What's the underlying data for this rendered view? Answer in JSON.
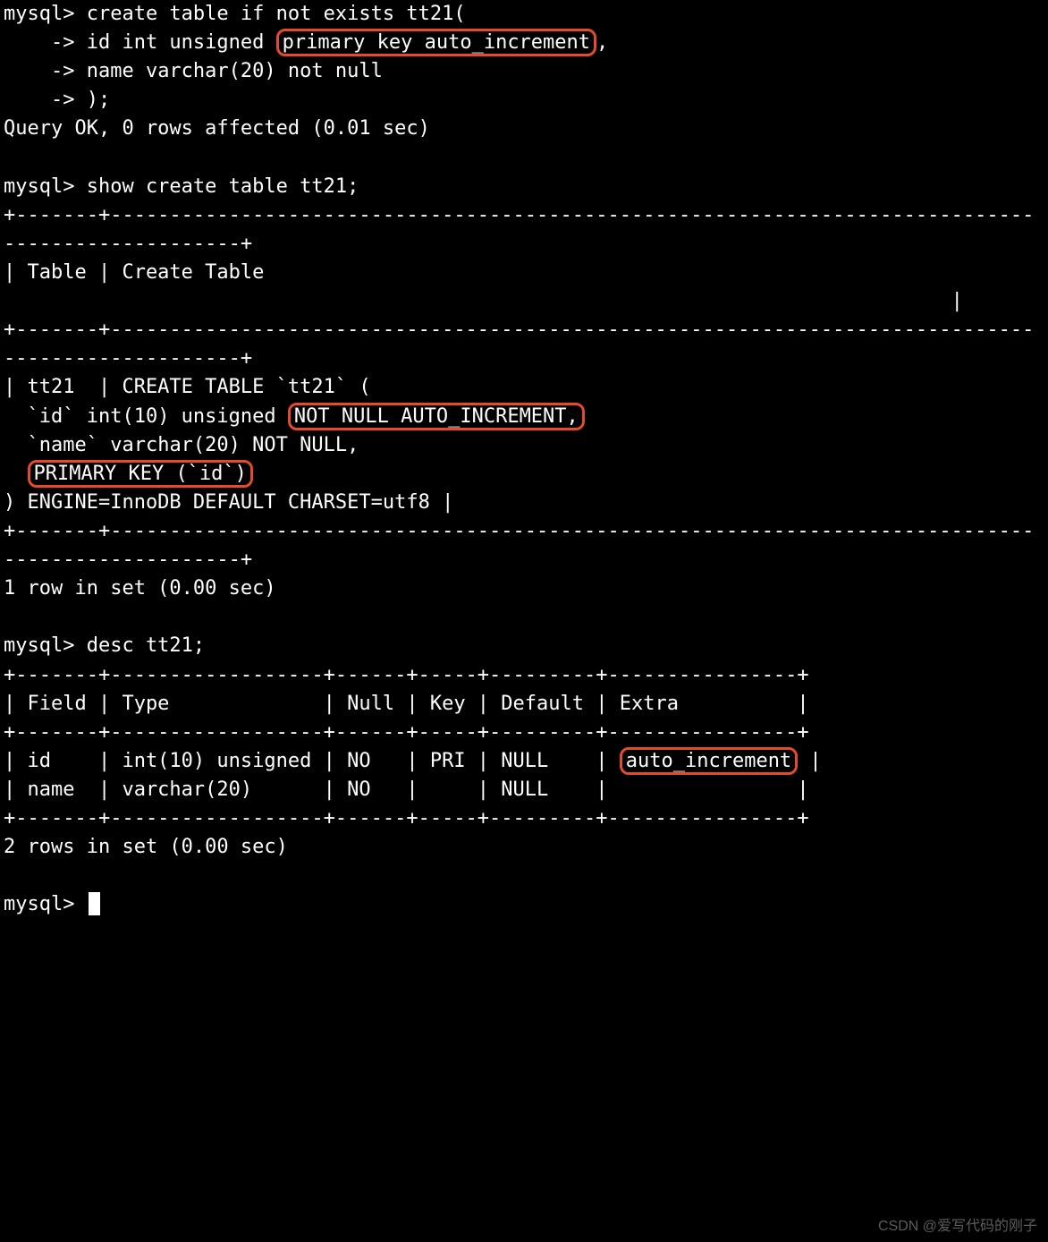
{
  "lines": {
    "l1a": "mysql> create table if not exists tt21(",
    "l2a": "    -> id int unsigned ",
    "l2b": "primary key auto_increment",
    "l2c": ",",
    "l3": "    -> name varchar(20) not null",
    "l4": "    -> );",
    "l5": "Query OK, 0 rows affected (0.01 sec)",
    "l6": "",
    "l7": "mysql> show create table tt21;",
    "l8": "+-------+--------------------------------------------------------------------------------------------------+",
    "l9": "| Table | Create Table                                                                                      ",
    "l9b": "                                                                                |",
    "l10": "+-------+--------------------------------------------------------------------------------------------------+",
    "l11": "| tt21  | CREATE TABLE `tt21` (",
    "l12a": "  `id` int(10) unsigned ",
    "l12b": "NOT NULL AUTO_INCREMENT,",
    "l13": "  `name` varchar(20) NOT NULL,",
    "l14a": "  ",
    "l14b": "PRIMARY KEY (`id`)",
    "l15": ") ENGINE=InnoDB DEFAULT CHARSET=utf8 |",
    "l16": "+-------+--------------------------------------------------------------------------------------------------+",
    "l17": "1 row in set (0.00 sec)",
    "l18": "",
    "l19": "mysql> desc tt21;",
    "l20": "+-------+------------------+------+-----+---------+----------------+",
    "l21": "| Field | Type             | Null | Key | Default | Extra          |",
    "l22": "+-------+------------------+------+-----+---------+----------------+",
    "l23a": "| id    | int(10) unsigned | NO   | PRI | NULL    | ",
    "l23b": "auto_increment",
    "l23c": " |",
    "l24": "| name  | varchar(20)      | NO   |     | NULL    |                |",
    "l25": "+-------+------------------+------+-----+---------+----------------+",
    "l26": "2 rows in set (0.00 sec)",
    "l27": "",
    "l28": "mysql> "
  },
  "watermark": "CSDN @爱写代码的刚子"
}
